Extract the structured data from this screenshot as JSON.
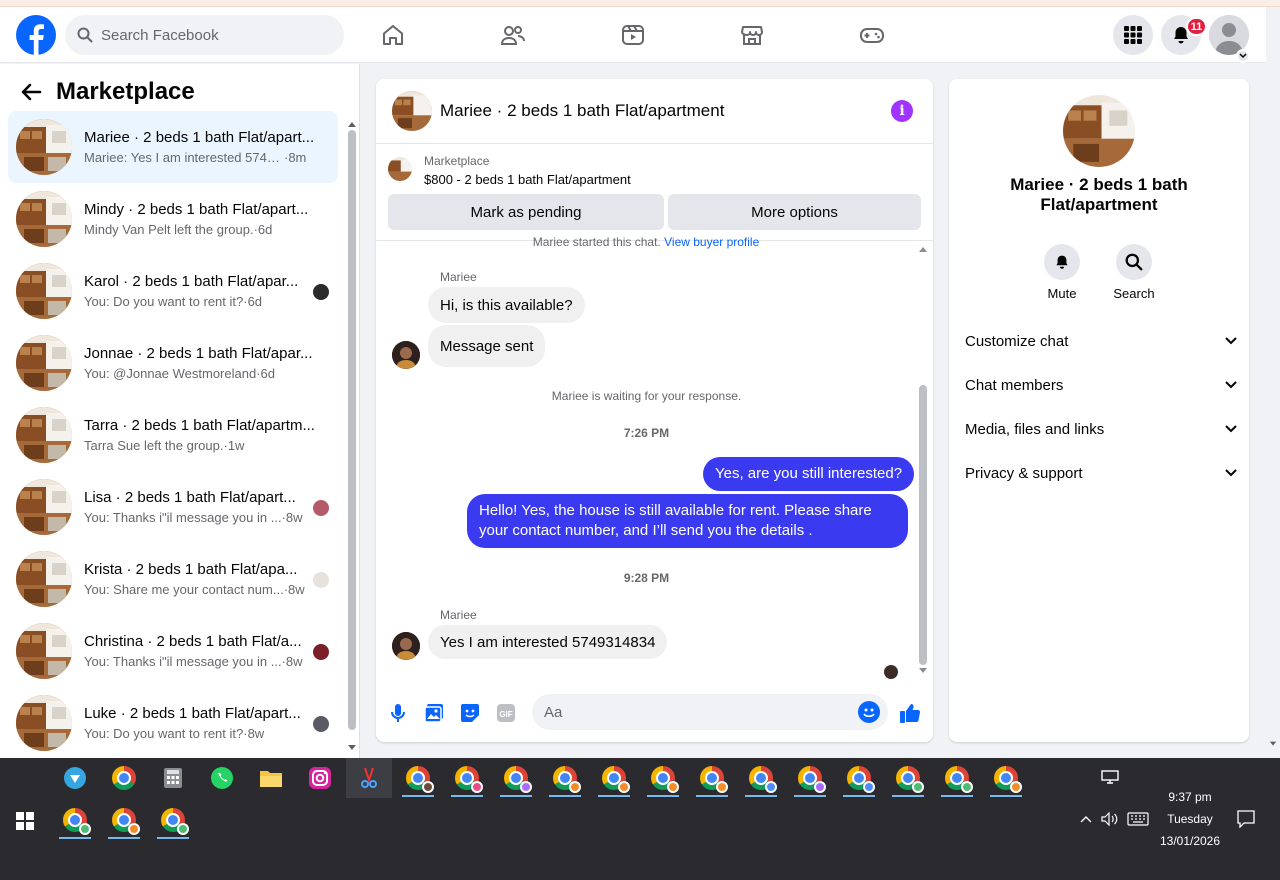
{
  "colors": {
    "brand": "#0866ff",
    "outgoing_bubble": "#3a3af0",
    "active_row": "#ebf5ff",
    "badge": "#e41e3f"
  },
  "navbar": {
    "search_placeholder": "Search Facebook",
    "notification_count": "11",
    "icons": [
      "home-icon",
      "friends-icon",
      "watch-icon",
      "marketplace-icon",
      "gaming-icon",
      "menu-grid-icon",
      "bell-icon"
    ]
  },
  "sidebar": {
    "title": "Marketplace",
    "conversations": [
      {
        "title": "Mariee · 2 beds 1 bath Flat/apart...",
        "snippet": "Mariee: Yes I am interested 57493...",
        "time": "·8m"
      },
      {
        "title": "Mindy · 2 beds 1 bath Flat/apart...",
        "snippet": "Mindy Van Pelt left the group.",
        "time": "·6d"
      },
      {
        "title": "Karol · 2 beds 1 bath Flat/apar...",
        "snippet": "You: Do you want to rent it?",
        "time": "·6d"
      },
      {
        "title": "Jonnae · 2 beds 1 bath Flat/apar...",
        "snippet": "You: @Jonnae Westmoreland",
        "time": "·6d"
      },
      {
        "title": "Tarra · 2 beds 1 bath Flat/apartm...",
        "snippet": "Tarra Sue left the group.",
        "time": "·1w"
      },
      {
        "title": "Lisa · 2 beds 1 bath Flat/apart...",
        "snippet": "You: Thanks i\"il message you in ...",
        "time": "·8w"
      },
      {
        "title": "Krista · 2 beds 1 bath Flat/apa...",
        "snippet": "You: Share me your contact num...",
        "time": "·8w"
      },
      {
        "title": "Christina · 2 beds 1 bath Flat/a...",
        "snippet": "You: Thanks i\"il message you in ...",
        "time": "·8w"
      },
      {
        "title": "Luke · 2 beds 1 bath Flat/apart...",
        "snippet": "You: Do you want to rent it?",
        "time": "·8w"
      }
    ]
  },
  "chat": {
    "title": "Mariee · 2 beds 1 bath Flat/apartment",
    "listing": {
      "category": "Marketplace",
      "name": "$800 - 2 beds 1 bath Flat/apartment",
      "mark_pending": "Mark as pending",
      "more_options": "More options"
    },
    "started_text": "Mariee started this chat.",
    "view_buyer": "View buyer profile",
    "sender": "Mariee",
    "incoming_1": "Hi, is this available?",
    "incoming_2": "Message sent",
    "waiting": "Mariee is waiting for your response.",
    "time_1": "7:26 PM",
    "outgoing_1": "Yes, are you still interested?",
    "outgoing_2": "Hello! Yes, the house is still available for rent. Please share your contact number, and I’ll send you the details .",
    "time_2": "9:28 PM",
    "sender_2": "Mariee",
    "incoming_3": "Yes I am interested 5749314834",
    "composer_placeholder": "Aa"
  },
  "right_panel": {
    "title": "Mariee · 2 beds 1 bath Flat/apartment",
    "mute_label": "Mute",
    "search_label": "Search",
    "rows": [
      "Customize chat",
      "Chat members",
      "Media, files and links",
      "Privacy & support"
    ]
  },
  "taskbar": {
    "time": "9:37 pm",
    "day": "Tuesday",
    "date": "13/01/2026"
  }
}
